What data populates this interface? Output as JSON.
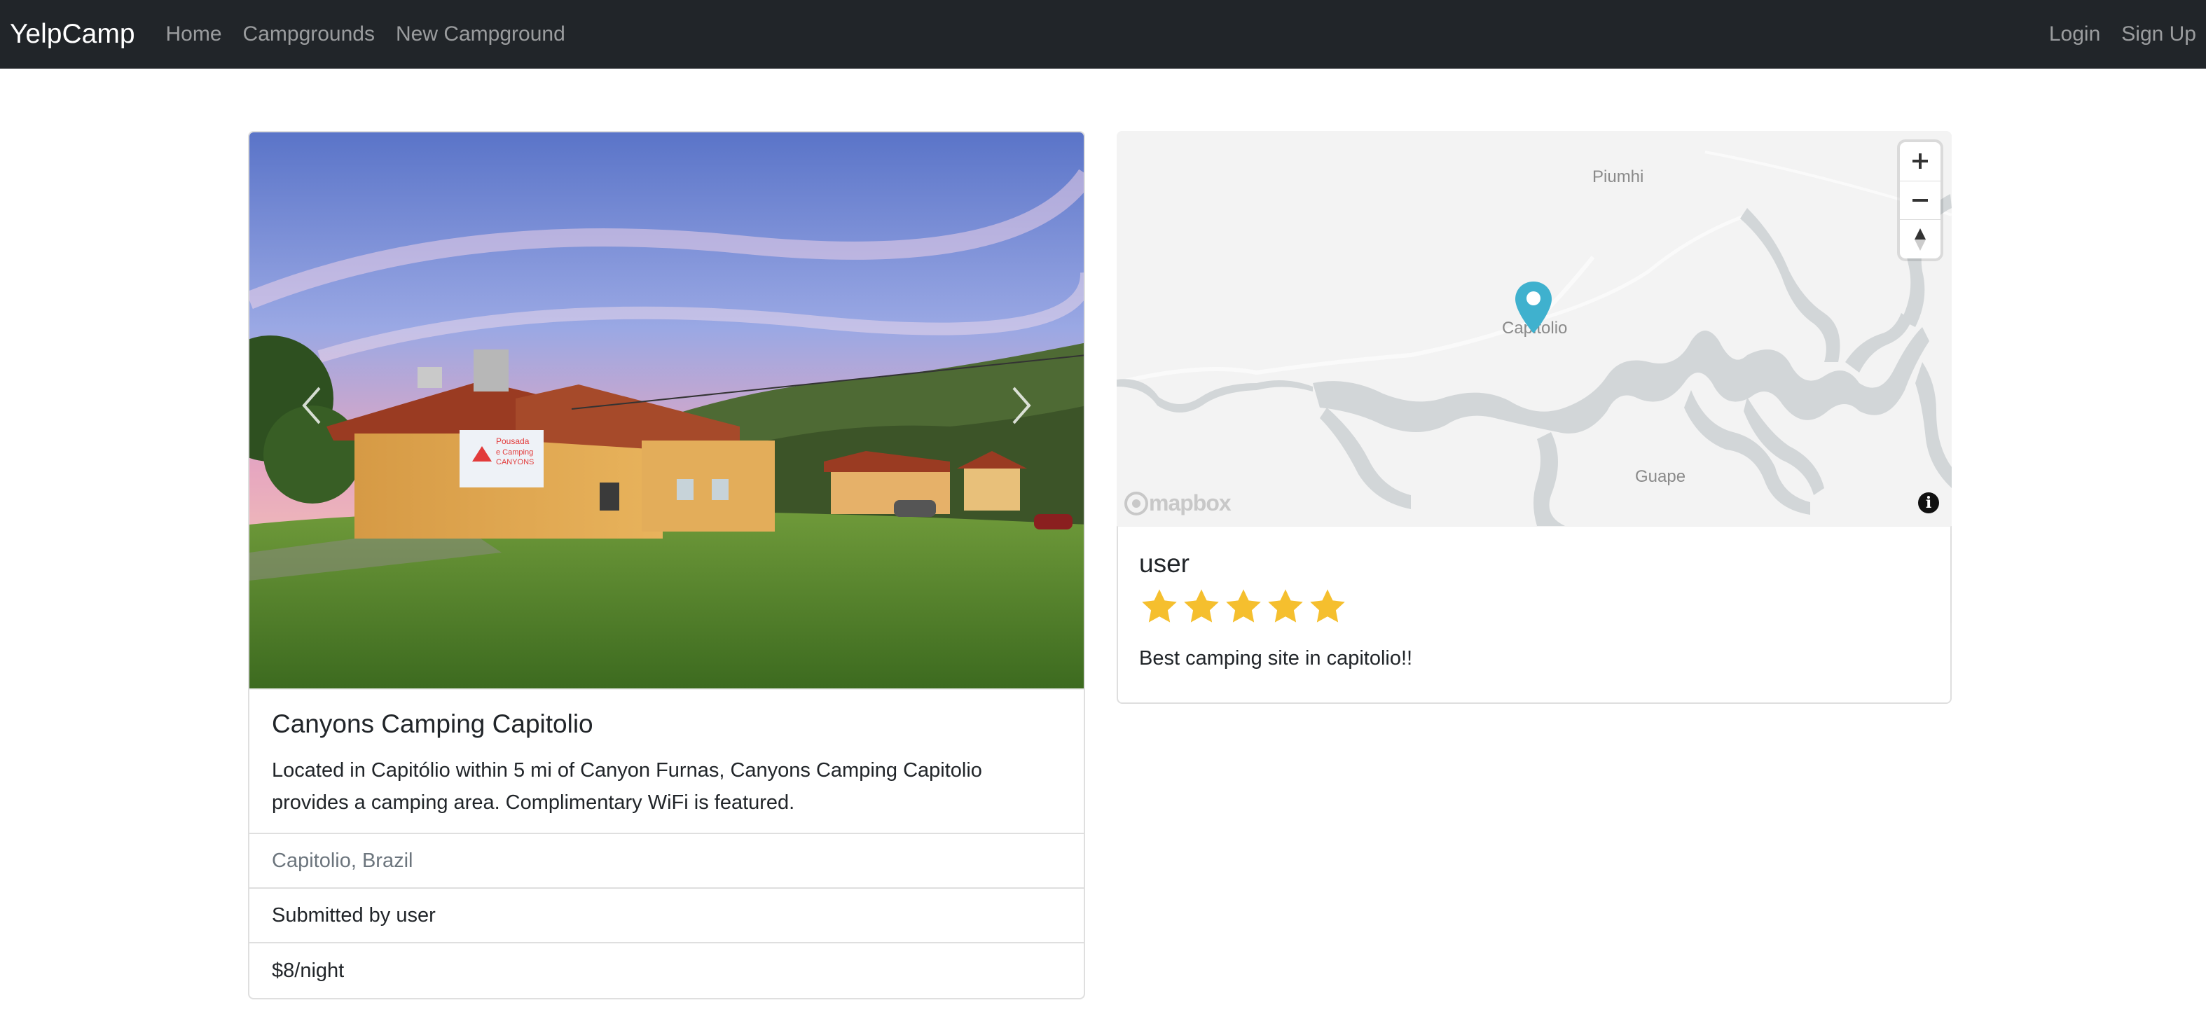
{
  "navbar": {
    "brand": "YelpCamp",
    "links": [
      "Home",
      "Campgrounds",
      "New Campground"
    ],
    "right_links": [
      "Login",
      "Sign Up"
    ],
    "background": "#212529"
  },
  "campground": {
    "title": "Canyons Camping Capitolio",
    "description": "Located in Capitólio within 5 mi of Canyon Furnas, Canyons Camping Capitolio provides a camping area. Complimentary WiFi is featured.",
    "location": "Capitolio, Brazil",
    "submitted_by": "Submitted by user",
    "price": "$8/night",
    "image_sign": {
      "line1": "Pousada",
      "line2": "e Camping",
      "line3": "CANYONS"
    },
    "carousel_prev_icon": "chevron-left-icon",
    "carousel_next_icon": "chevron-right-icon"
  },
  "map": {
    "labels": {
      "town1": "Piumhi",
      "town2": "Capitolio",
      "town3": "Guape"
    },
    "attribution": "mapbox",
    "pin_color": "#3fb1ce",
    "controls": [
      "zoom-in-icon",
      "zoom-out-icon",
      "compass-icon"
    ],
    "info_icon": "info-icon"
  },
  "review": {
    "author": "user",
    "rating": 5,
    "max_rating": 5,
    "star_color": "#f5bf2e",
    "body": "Best camping site in capitolio!!"
  }
}
